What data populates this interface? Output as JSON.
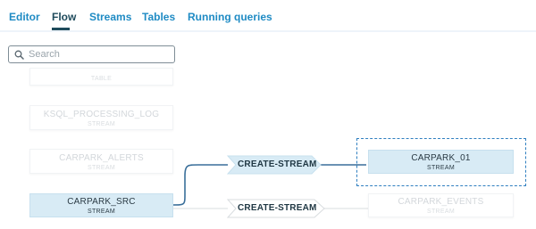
{
  "tabs": [
    {
      "label": "Editor",
      "active": false
    },
    {
      "label": "Flow",
      "active": true
    },
    {
      "label": "Streams",
      "active": false
    },
    {
      "label": "Tables",
      "active": false
    },
    {
      "label": "Running queries",
      "active": false
    }
  ],
  "search": {
    "placeholder": "Search",
    "value": ""
  },
  "nodes": [
    {
      "name": "",
      "type": "TABLE"
    },
    {
      "name": "KSQL_PROCESSING_LOG",
      "type": "STREAM"
    },
    {
      "name": "CARPARK_ALERTS",
      "type": "STREAM"
    },
    {
      "name": "CARPARK_SRC",
      "type": "STREAM"
    },
    {
      "name": "CARPARK_01",
      "type": "STREAM"
    },
    {
      "name": "CARPARK_EVENTS",
      "type": "STREAM"
    }
  ],
  "operations": [
    "CREATE-STREAM",
    "CREATE-STREAM"
  ],
  "colors": {
    "accent": "#1f8bc4",
    "active_tab": "#1f4b5c",
    "selected_node": "#d8ebf5",
    "connector": "#3a6f9a",
    "dashed": "#2f7fc0"
  }
}
